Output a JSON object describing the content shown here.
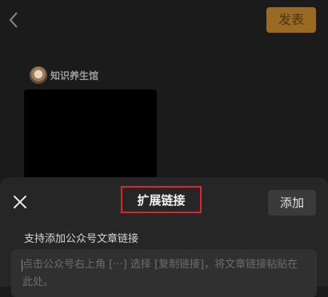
{
  "topbar": {
    "back_icon": "chevron-left-icon",
    "publish_label": "发表",
    "publish_color": "#9a6a22"
  },
  "article": {
    "author_name": "知识养生馆",
    "avatar_icon": "avatar"
  },
  "sheet": {
    "close_icon": "close-icon",
    "title": "扩展链接",
    "highlight_color": "#e0242a",
    "add_label": "添加",
    "hint": "支持添加公众号文章链接",
    "placeholder": "点击公众号右上角 [···] 选择 [复制链接]，将文章链接粘贴在此处。"
  }
}
